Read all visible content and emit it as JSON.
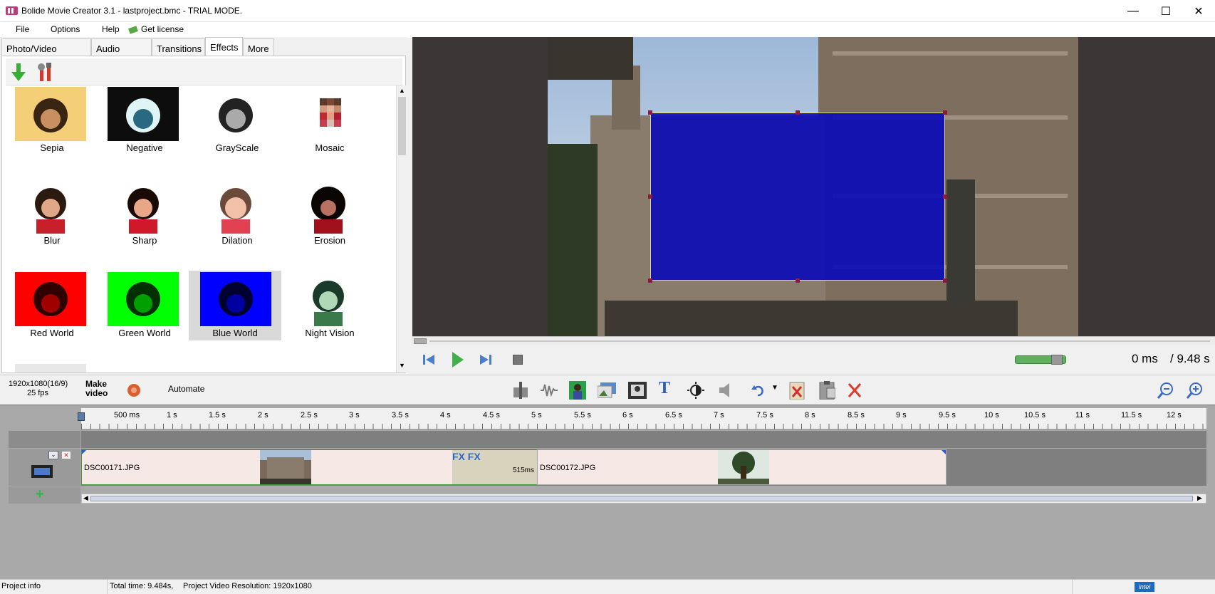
{
  "window": {
    "title": "Bolide Movie Creator 3.1 - lastproject.bmc  - TRIAL MODE.",
    "minimize": "—",
    "maximize": "☐",
    "close": "✕"
  },
  "menu": {
    "file": "File",
    "options": "Options",
    "help": "Help",
    "get_license": "Get license"
  },
  "tabs": [
    {
      "label": "Photo/Video Library"
    },
    {
      "label": "Audio Library"
    },
    {
      "label": "Transitions"
    },
    {
      "label": "Effects",
      "active": true
    },
    {
      "label": "More"
    }
  ],
  "effects": [
    {
      "label": "Sepia",
      "color": "#f4cf78"
    },
    {
      "label": "Negative",
      "color": "#1a1a1a"
    },
    {
      "label": "GrayScale",
      "color": "#e8e8e8"
    },
    {
      "label": "Mosaic",
      "color": "#ffffff"
    },
    {
      "label": "Blur",
      "color": "#ffffff"
    },
    {
      "label": "Sharp",
      "color": "#ffffff"
    },
    {
      "label": "Dilation",
      "color": "#ffffff"
    },
    {
      "label": "Erosion",
      "color": "#ffffff"
    },
    {
      "label": "Red World",
      "color": "#ff0000"
    },
    {
      "label": "Green World",
      "color": "#00ff00"
    },
    {
      "label": "Blue World",
      "color": "#0000ff",
      "selected": true
    },
    {
      "label": "Night Vision",
      "color": "#ffffff"
    }
  ],
  "player": {
    "current_time": "0 ms",
    "total_time": "/ 9.48 s"
  },
  "toolbar2": {
    "resolution": "1920x1080(16/9)",
    "fps": "25 fps",
    "make_video": "Make video",
    "automate": "Automate"
  },
  "ruler": [
    "500 ms",
    "1 s",
    "1.5 s",
    "2 s",
    "2.5 s",
    "3 s",
    "3.5 s",
    "4 s",
    "4.5 s",
    "5 s",
    "5.5 s",
    "6 s",
    "6.5 s",
    "7 s",
    "7.5 s",
    "8 s",
    "8.5 s",
    "9 s",
    "9.5 s",
    "10 s",
    "10.5 s",
    "11 s",
    "11.5 s",
    "12 s"
  ],
  "clips": [
    {
      "name": "DSC00171.JPG",
      "fx": "FX FX",
      "transition": "515ms"
    },
    {
      "name": "DSC00172.JPG"
    }
  ],
  "status": {
    "project_info": "Project info",
    "total_time": "Total time: 9.484s,",
    "resolution": "Project Video Resolution:   1920x1080",
    "intel_badge": "intel"
  },
  "colors": {
    "overlay_blue": "#0a0ab8",
    "play_green": "#3fb04a",
    "delete_red": "#e03a2a",
    "clip_border_green": "#3a9a3a"
  }
}
